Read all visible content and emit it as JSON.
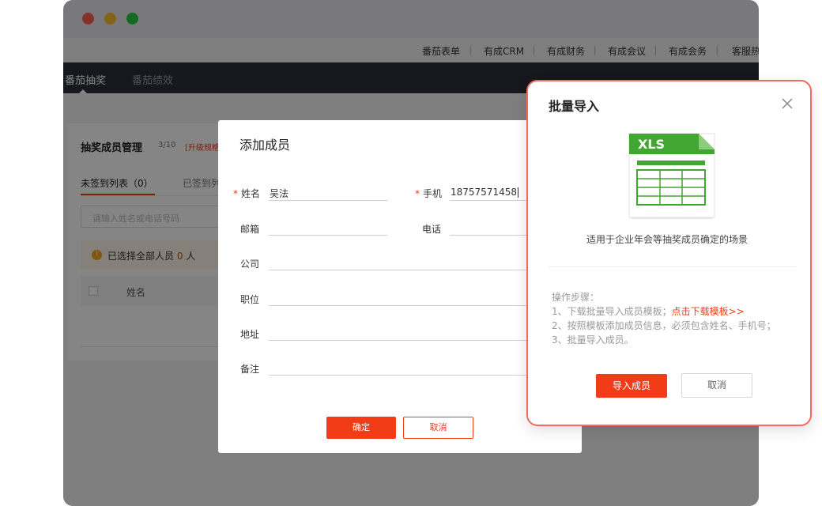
{
  "top_links": [
    "番茄表单",
    "有成CRM",
    "有成财务",
    "有成会议",
    "有成会务",
    "客服热"
  ],
  "main_tabs": [
    {
      "label": "番茄抽奖",
      "active": true
    },
    {
      "label": "番茄绩效",
      "active": false
    }
  ],
  "page": {
    "title": "抽奖成员管理",
    "count": "3/10",
    "upgrade_link": "[升级规格",
    "tabs": [
      "未签到列表（0）",
      "已签到列"
    ],
    "search_placeholder": "请输入姓名或电话号码",
    "selection_prefix": "已选择全部人员",
    "selection_count": "0",
    "selection_suffix": "人",
    "column_name": "姓名"
  },
  "add_member": {
    "title": "添加成员",
    "fields": {
      "name": {
        "label": "姓名",
        "value": "吴法",
        "required": true
      },
      "phone": {
        "label": "手机",
        "value": "18757571458",
        "required": true
      },
      "email": {
        "label": "邮箱",
        "value": ""
      },
      "tel": {
        "label": "电话",
        "value": ""
      },
      "company": {
        "label": "公司",
        "value": ""
      },
      "position": {
        "label": "职位",
        "value": ""
      },
      "address": {
        "label": "地址",
        "value": ""
      },
      "remark": {
        "label": "备注",
        "value": ""
      }
    },
    "required_mark": "*",
    "confirm_label": "确定",
    "cancel_label": "取消"
  },
  "batch_import": {
    "title": "批量导入",
    "file_badge": "XLS",
    "description": "适用于企业年会等抽奖成员确定的场景",
    "steps_title": "操作步骤：",
    "step1": "1、下载批量导入成员模板；",
    "step1_link": "点击下载模板>>",
    "step2": "2、按照模板添加成员信息，必须包含姓名、手机号；",
    "step3": "3、批量导入成员。",
    "import_label": "导入成员",
    "cancel_label": "取消"
  },
  "colors": {
    "accent": "#f23c17",
    "highlight_border": "#f26a5e",
    "nav_dark": "#2b2f38",
    "xls_green": "#43a533",
    "traffic_red": "#fe5f57",
    "traffic_yellow": "#febc2e",
    "traffic_green": "#28c840"
  }
}
